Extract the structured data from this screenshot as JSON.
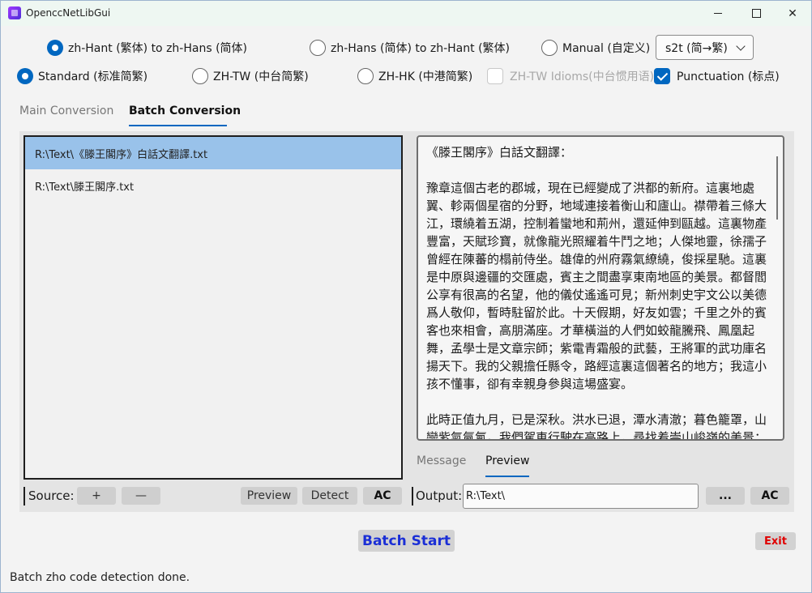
{
  "window": {
    "title": "OpenccNetLibGui"
  },
  "conversion_direction": {
    "options": [
      {
        "label": "zh-Hant (繁体) to zh-Hans (简体)",
        "selected": true
      },
      {
        "label": "zh-Hans (简体) to zh-Hant (繁体)",
        "selected": false
      },
      {
        "label": "Manual (自定义)",
        "selected": false
      }
    ],
    "manual_config": {
      "value": "s2t (简→繁)"
    }
  },
  "region": {
    "options": [
      {
        "label": "Standard (标准简繁)",
        "selected": true
      },
      {
        "label": "ZH-TW (中台简繁)",
        "selected": false
      },
      {
        "label": "ZH-HK (中港简繁)",
        "selected": false
      }
    ],
    "zhtw_idioms": {
      "label": "ZH-TW Idioms(中台惯用语)",
      "checked": false,
      "disabled": true
    },
    "punctuation": {
      "label": "Punctuation (标点)",
      "checked": true
    }
  },
  "tabs": [
    {
      "label": "Main Conversion",
      "active": false
    },
    {
      "label": "Batch Conversion",
      "active": true
    }
  ],
  "source_files": [
    {
      "path": "R:\\Text\\《滕王閣序》白話文翻譯.txt",
      "selected": true
    },
    {
      "path": "R:\\Text\\滕王閣序.txt",
      "selected": false
    }
  ],
  "preview": {
    "text": "《滕王閣序》白話文翻譯：\n\n豫章這個古老的郡城，現在已經變成了洪都的新府。這裏地處翼、軫兩個星宿的分野，地域連接着衡山和廬山。襟帶着三條大江，環繞着五湖，控制着蠻地和荊州，還延伸到甌越。這裏物產豐富，天賦珍寶，就像龍光照耀着牛鬥之地；人傑地靈，徐孺子曾經在陳蕃的榻前侍坐。雄偉的州府霧氣繚繞，俊採星馳。這裏是中原與邊疆的交匯處，賓主之間盡享東南地區的美景。都督閻公享有很高的名望，他的儀仗遙遙可見；新州刺史宇文公以美德爲人敬仰，暫時駐留於此。十天假期，好友如雲；千里之外的賓客也來相會，高朋滿座。才華橫溢的人們如蛟龍騰飛、鳳凰起舞，孟學士是文章宗師；紫電青霜般的武藝，王將軍的武功庫名揚天下。我的父親擔任縣令，路經這裏這個著名的地方；我這小孩不懂事，卻有幸親身參與這場盛宴。\n\n此時正值九月，已是深秋。洪水已退，潭水清澈；暮色籠罩，山巒紫氣氤氳。我們駕車行駛在高路上，尋找着崇山峻嶺的美景；來到帝王后代的長洲，入住昔日天人共居的宮殿。層層山"
  },
  "sub_tabs": [
    {
      "label": "Message",
      "active": false
    },
    {
      "label": "Preview",
      "active": true
    }
  ],
  "source_bar": {
    "label": "Source:",
    "add_label": "+",
    "remove_label": "—",
    "preview_label": "Preview",
    "detect_label": "Detect",
    "clear_label": "AC"
  },
  "output_bar": {
    "label": "Output:",
    "path": "R:\\Text\\",
    "browse_label": "...",
    "clear_label": "AC"
  },
  "actions": {
    "start_label": "Batch Start",
    "exit_label": "Exit"
  },
  "status": {
    "text": "Batch zho code detection done."
  },
  "colors": {
    "accent": "#0067c0",
    "selection": "#99c2ea",
    "start": "#1b2fd6",
    "exit": "#e00000"
  }
}
